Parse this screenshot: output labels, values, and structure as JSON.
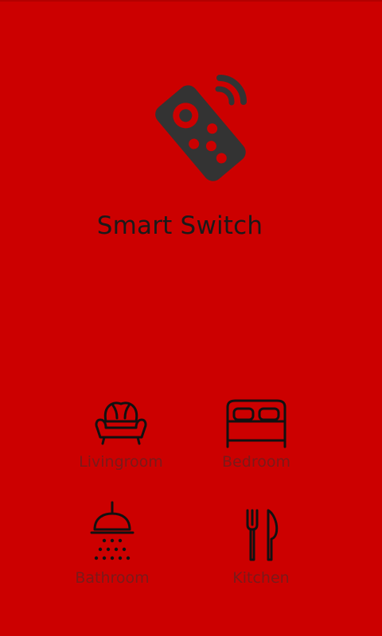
{
  "app": {
    "title": "Smart Switch",
    "logo_icon": "remote-control-icon"
  },
  "rooms": [
    {
      "label": "Livingroom",
      "icon": "armchair-icon"
    },
    {
      "label": "Bedroom",
      "icon": "bed-icon"
    },
    {
      "label": "Bathroom",
      "icon": "shower-icon"
    },
    {
      "label": "Kitchen",
      "icon": "fork-knife-icon"
    }
  ],
  "colors": {
    "background": "#cc0000",
    "icon": "#333333",
    "title": "#1a1a1a",
    "label": "#7a1a1a"
  }
}
